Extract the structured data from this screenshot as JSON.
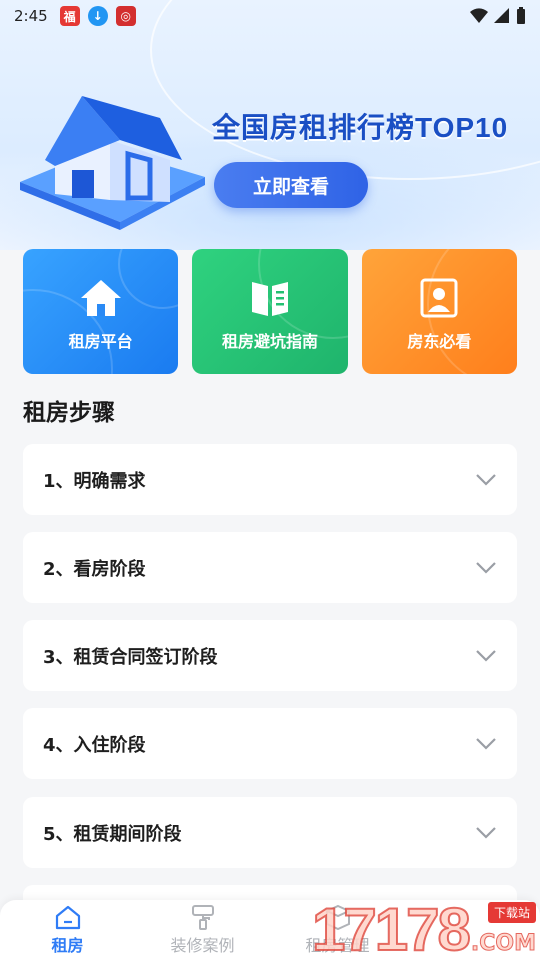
{
  "status_bar": {
    "time": "2:45"
  },
  "banner": {
    "title": "全国房租排行榜TOP10",
    "button_label": "立即查看"
  },
  "cards": [
    {
      "label": "租房平台",
      "icon": "house-icon",
      "color": "#1a7bf0"
    },
    {
      "label": "租房避坑指南",
      "icon": "book-icon",
      "color": "#1fb46c"
    },
    {
      "label": "房东必看",
      "icon": "portrait-icon",
      "color": "#ff7f1c"
    }
  ],
  "steps_section": {
    "title": "租房步骤",
    "items": [
      {
        "label": "1、明确需求"
      },
      {
        "label": "2、看房阶段"
      },
      {
        "label": "3、租赁合同签订阶段"
      },
      {
        "label": "4、入住阶段"
      },
      {
        "label": "5、租赁期间阶段"
      }
    ]
  },
  "bottom_nav": {
    "items": [
      {
        "label": "租房",
        "icon": "home-icon",
        "active": true
      },
      {
        "label": "装修案例",
        "icon": "paint-roller-icon",
        "active": false
      },
      {
        "label": "租房管理",
        "icon": "box-icon",
        "active": false
      }
    ],
    "active_color": "#2f7cf6"
  },
  "watermark": {
    "digits": "17178",
    "tag": "下载站",
    "suffix": ".COM"
  }
}
